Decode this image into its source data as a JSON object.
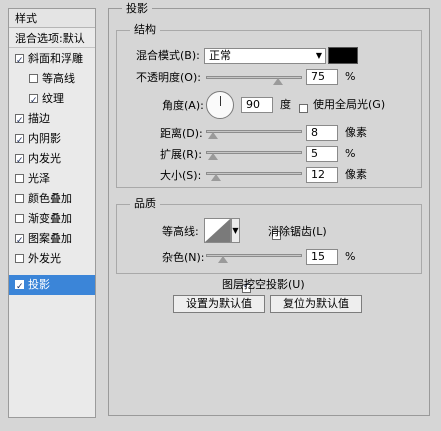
{
  "sidebar": {
    "header": "样式",
    "blend_options": "混合选项:默认",
    "items": [
      {
        "label": "斜面和浮雕",
        "checked": true
      },
      {
        "label": "等高线",
        "checked": false
      },
      {
        "label": "纹理",
        "checked": true
      },
      {
        "label": "描边",
        "checked": true
      },
      {
        "label": "内阴影",
        "checked": true
      },
      {
        "label": "内发光",
        "checked": true
      },
      {
        "label": "光泽",
        "checked": false
      },
      {
        "label": "颜色叠加",
        "checked": false
      },
      {
        "label": "渐变叠加",
        "checked": false
      },
      {
        "label": "图案叠加",
        "checked": true
      },
      {
        "label": "外发光",
        "checked": false
      },
      {
        "label": "投影",
        "checked": true
      }
    ]
  },
  "panel": {
    "title": "投影",
    "structure": {
      "title": "结构",
      "blend_mode_label": "混合模式(B):",
      "blend_mode_value": "正常",
      "color": "#000000",
      "opacity_label": "不透明度(O):",
      "opacity_value": "75",
      "opacity_unit": "%",
      "opacity_level": 0.75,
      "angle_label": "角度(A):",
      "angle_value": "90",
      "angle_unit": "度",
      "global_light_label": "使用全局光(G)",
      "global_light_checked": false,
      "distance_label": "距离(D):",
      "distance_value": "8",
      "distance_unit": "像素",
      "spread_label": "扩展(R):",
      "spread_value": "5",
      "spread_unit": "%",
      "size_label": "大小(S):",
      "size_value": "12",
      "size_unit": "像素"
    },
    "quality": {
      "title": "品质",
      "contour_label": "等高线:",
      "antialias_label": "消除锯齿(L)",
      "antialias_checked": false,
      "noise_label": "杂色(N):",
      "noise_value": "15",
      "noise_unit": "%"
    },
    "knockout_label": "图层挖空投影(U)",
    "knockout_checked": true,
    "set_default_button": "设置为默认值",
    "reset_default_button": "复位为默认值"
  }
}
